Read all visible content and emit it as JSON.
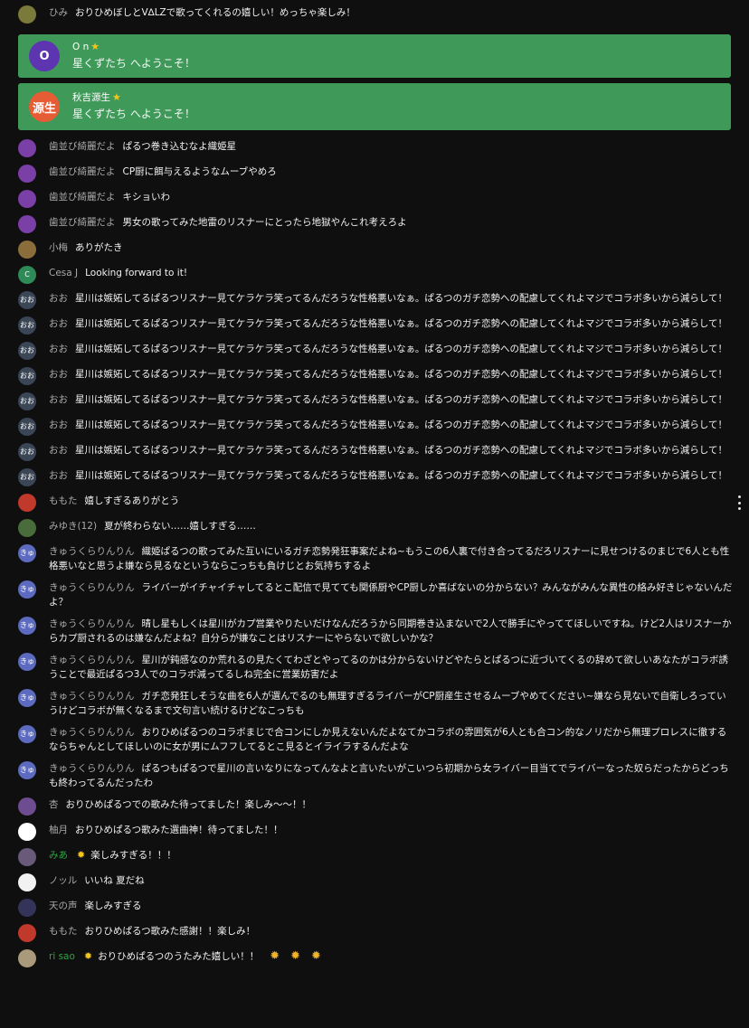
{
  "super_chats": [
    {
      "initial": "O",
      "author": "O n",
      "color": "#5e35b1",
      "message": "星くずたち へようこそ！"
    },
    {
      "initial": "源生",
      "author": "秋吉源生",
      "color": "#e65c34",
      "message": "星くずたち へようこそ！"
    }
  ],
  "first": {
    "initial": "",
    "author": "ひみ",
    "color": "#7a7a3a",
    "message": "おりひめぼしとV∆LZで歌ってくれるの嬉しい！めっちゃ楽しみ！"
  },
  "messages": [
    {
      "initial": "",
      "author": "歯並び綺麗だよ",
      "color": "#7b3fa8",
      "message": "ぱるつ巻き込むなよ織姫星"
    },
    {
      "initial": "",
      "author": "歯並び綺麗だよ",
      "color": "#7b3fa8",
      "message": "CP厨に餌与えるようなムーブやめろ"
    },
    {
      "initial": "",
      "author": "歯並び綺麗だよ",
      "color": "#7b3fa8",
      "message": "キショいわ"
    },
    {
      "initial": "",
      "author": "歯並び綺麗だよ",
      "color": "#7b3fa8",
      "message": "男女の歌ってみた地雷のリスナーにとったら地獄やんこれ考えろよ"
    },
    {
      "initial": "",
      "author": "小梅",
      "color": "#8a6d3b",
      "message": "ありがたき"
    },
    {
      "initial": "C",
      "author": "Cesa J",
      "color": "#2e8b57",
      "message": "Looking forward to it!"
    },
    {
      "initial": "おお",
      "author": "おお",
      "color": "#3a4656",
      "message": "星川は嫉妬してるぱるつリスナー見てケラケラ笑ってるんだろうな性格悪いなぁ。ぱるつのガチ恋勢への配慮してくれよマジでコラボ多いから減らして！"
    },
    {
      "initial": "おお",
      "author": "おお",
      "color": "#3a4656",
      "message": "星川は嫉妬してるぱるつリスナー見てケラケラ笑ってるんだろうな性格悪いなぁ。ぱるつのガチ恋勢への配慮してくれよマジでコラボ多いから減らして！"
    },
    {
      "initial": "おお",
      "author": "おお",
      "color": "#3a4656",
      "message": "星川は嫉妬してるぱるつリスナー見てケラケラ笑ってるんだろうな性格悪いなぁ。ぱるつのガチ恋勢への配慮してくれよマジでコラボ多いから減らして！"
    },
    {
      "initial": "おお",
      "author": "おお",
      "color": "#3a4656",
      "message": "星川は嫉妬してるぱるつリスナー見てケラケラ笑ってるんだろうな性格悪いなぁ。ぱるつのガチ恋勢への配慮してくれよマジでコラボ多いから減らして！"
    },
    {
      "initial": "おお",
      "author": "おお",
      "color": "#3a4656",
      "message": "星川は嫉妬してるぱるつリスナー見てケラケラ笑ってるんだろうな性格悪いなぁ。ぱるつのガチ恋勢への配慮してくれよマジでコラボ多いから減らして！"
    },
    {
      "initial": "おお",
      "author": "おお",
      "color": "#3a4656",
      "message": "星川は嫉妬してるぱるつリスナー見てケラケラ笑ってるんだろうな性格悪いなぁ。ぱるつのガチ恋勢への配慮してくれよマジでコラボ多いから減らして！"
    },
    {
      "initial": "おお",
      "author": "おお",
      "color": "#3a4656",
      "message": "星川は嫉妬してるぱるつリスナー見てケラケラ笑ってるんだろうな性格悪いなぁ。ぱるつのガチ恋勢への配慮してくれよマジでコラボ多いから減らして！"
    },
    {
      "initial": "おお",
      "author": "おお",
      "color": "#3a4656",
      "message": "星川は嫉妬してるぱるつリスナー見てケラケラ笑ってるんだろうな性格悪いなぁ。ぱるつのガチ恋勢への配慮してくれよマジでコラボ多いから減らして！"
    },
    {
      "initial": "",
      "author": "ももた",
      "color": "#c0392b",
      "message": "嬉しすぎるありがとう"
    },
    {
      "initial": "",
      "author": "みゆき(12)",
      "color": "#4a6b3a",
      "message": "夏が終わらない……嬉しすぎる……"
    },
    {
      "initial": "きゅ",
      "author": "きゅうくらりんりん",
      "color": "#5c6bc0",
      "message": "織姫ぱるつの歌ってみた互いにいるガチ恋勢発狂事案だよね~もうこの6人裏で付き合ってるだろリスナーに見せつけるのまじで6人とも性格悪いなと思うよ嫌なら見るなというならこっちも負けじとお気持ちするよ"
    },
    {
      "initial": "きゅ",
      "author": "きゅうくらりんりん",
      "color": "#5c6bc0",
      "message": "ライバーがイチャイチャしてるとこ配信で見てても関係厨やCP厨しか喜ばないの分からない？みんながみんな異性の絡み好きじゃないんだよ？"
    },
    {
      "initial": "きゅ",
      "author": "きゅうくらりんりん",
      "color": "#5c6bc0",
      "message": "晴し星もしくは星川がカプ営業やりたいだけなんだろうから同期巻き込まないで2人で勝手にやっててほしいですね。けど2人はリスナーからカプ厨されるのは嫌なんだよね？自分らが嫌なことはリスナーにやらないで欲しいかな？"
    },
    {
      "initial": "きゅ",
      "author": "きゅうくらりんりん",
      "color": "#5c6bc0",
      "message": "星川が鈍感なのか荒れるの見たくてわざとやってるのかは分からないけどやたらとぱるつに近づいてくるの辞めて欲しいあなたがコラボ誘うことで最近ぱるつ3人でのコラボ減ってるしね完全に営業妨害だよ"
    },
    {
      "initial": "きゅ",
      "author": "きゅうくらりんりん",
      "color": "#5c6bc0",
      "message": "ガチ恋発狂しそうな曲を6人が選んでるのも無理すぎるライバーがCP厨産生させるムーブやめてください~嫌なら見ないで自衛しろっていうけどコラボが無くなるまで文句言い続けるけどなこっちも"
    },
    {
      "initial": "きゅ",
      "author": "きゅうくらりんりん",
      "color": "#5c6bc0",
      "message": "おりひめぱるつのコラボまじで合コンにしか見えないんだよなてかコラボの雰囲気が6人とも合コン的なノリだから無理プロレスに徹するならちゃんとしてほしいのに女が男にムフフしてるとこ見るとイライラするんだよな"
    },
    {
      "initial": "きゅ",
      "author": "きゅうくらりんりん",
      "color": "#5c6bc0",
      "message": "ぱるつもぱるつで星川の言いなりになってんなよと言いたいがこいつら初期から女ライバー目当てでライバーなった奴らだったからどっちも終わってるんだったわ"
    },
    {
      "initial": "",
      "author": "杏",
      "color": "#6d4c8f",
      "message": "おりひめぱるつでの歌みた待ってました！楽しみ〜〜！！"
    },
    {
      "initial": "",
      "author": "柚月",
      "color": "#ffffff",
      "message": "おりひめぱるつ歌みた選曲神！待ってました！！"
    },
    {
      "initial": "",
      "author": "みあ",
      "color": "#6a5a7a",
      "message": "楽しみすぎる！！！",
      "member": true
    },
    {
      "initial": "",
      "author": "ノッル",
      "color": "#f2f2f2",
      "message": "いいね 夏だね"
    },
    {
      "initial": "",
      "author": "天の声",
      "color": "#34345a",
      "message": "楽しみすぎる"
    },
    {
      "initial": "",
      "author": "ももた",
      "color": "#c0392b",
      "message": "おりひめぱるつ歌みた感謝！！楽しみ！"
    },
    {
      "initial": "",
      "author": "ri sao",
      "color": "#a89a7a",
      "message": "おりひめぱるつのうたみた嬉しい！！",
      "member": true
    }
  ]
}
